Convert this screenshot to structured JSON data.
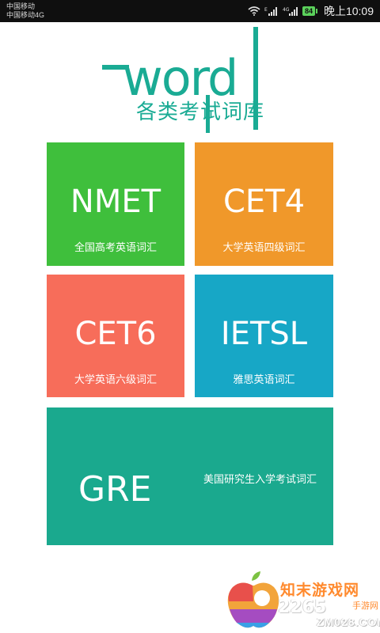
{
  "status_bar": {
    "carrier_1": "中国移动",
    "carrier_2": "中国移动4G",
    "icons": [
      "wifi-icon",
      "signal-e-icon",
      "signal-4g-icon"
    ],
    "battery": "84",
    "time": "晚上10:09"
  },
  "logo": {
    "word": "word",
    "subtitle": "各类考试词库",
    "color": "#1aab94"
  },
  "tiles": [
    {
      "title": "NMET",
      "desc": "全国高考英语词汇",
      "color": "#3fbf3c"
    },
    {
      "title": "CET4",
      "desc": "大学英语四级词汇",
      "color": "#f0982a"
    },
    {
      "title": "CET6",
      "desc": "大学英语六级词汇",
      "color": "#f76d5a"
    },
    {
      "title": "IETSL",
      "desc": "雅思英语词汇",
      "color": "#17a7c6"
    },
    {
      "title": "GRE",
      "desc": "美国研究生入学考试词汇",
      "color": "#1aa98e"
    }
  ],
  "watermark": {
    "name": "知末游戏网",
    "sub": "手游网",
    "num": "2265",
    "domain": "ZM028.COM"
  }
}
